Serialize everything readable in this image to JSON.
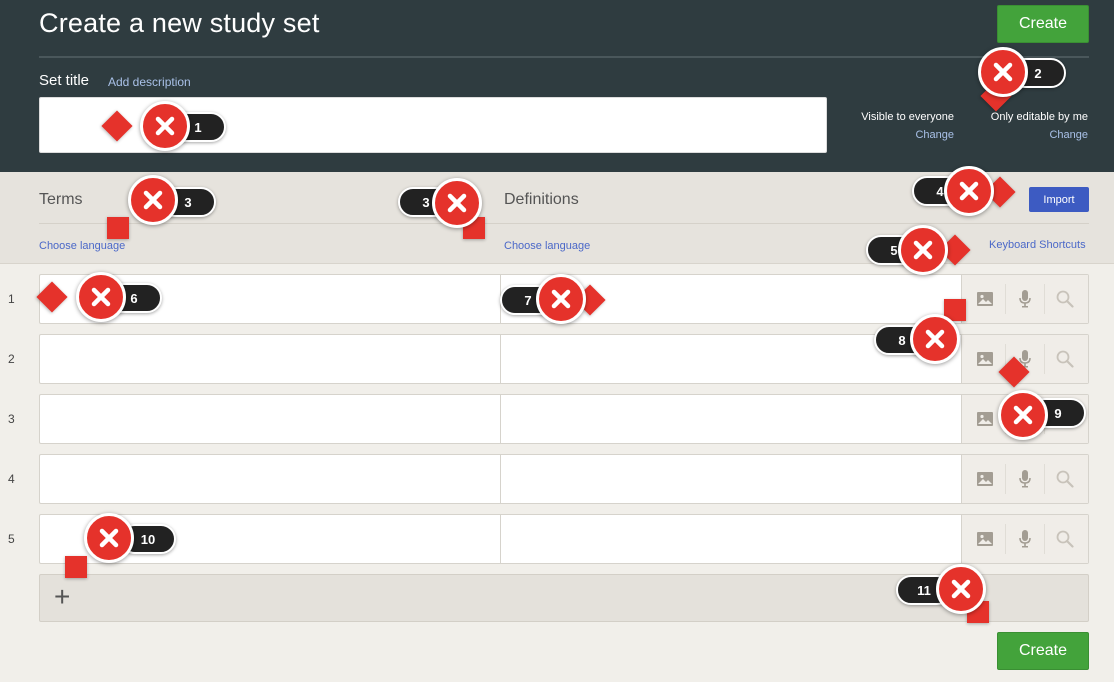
{
  "header": {
    "title": "Create a new study set",
    "create_label": "Create",
    "set_title_label": "Set title",
    "add_description_label": "Add description",
    "visibility": {
      "visible_label": "Visible to everyone",
      "visible_change": "Change",
      "editable_label": "Only editable by me",
      "editable_change": "Change"
    }
  },
  "columns": {
    "terms_label": "Terms",
    "definitions_label": "Definitions",
    "choose_language": "Choose language",
    "import_label": "Import",
    "keyboard_shortcuts": "Keyboard Shortcuts"
  },
  "rows": [
    {
      "number": "1"
    },
    {
      "number": "2"
    },
    {
      "number": "3"
    },
    {
      "number": "4"
    },
    {
      "number": "5"
    }
  ],
  "footer": {
    "create_label": "Create"
  },
  "markers": [
    "1",
    "2",
    "3",
    "3",
    "4",
    "5",
    "6",
    "7",
    "8",
    "9",
    "10",
    "11"
  ],
  "icons": {
    "image": "image-icon",
    "mic": "microphone-icon",
    "search": "search-icon",
    "plus": "plus-icon",
    "close": "close-icon"
  },
  "colors": {
    "header_bg": "#2f3c40",
    "create_green": "#43a33b",
    "import_blue": "#3d5bc2",
    "link_blue": "#4b68c8",
    "marker_red": "#e5322b"
  }
}
